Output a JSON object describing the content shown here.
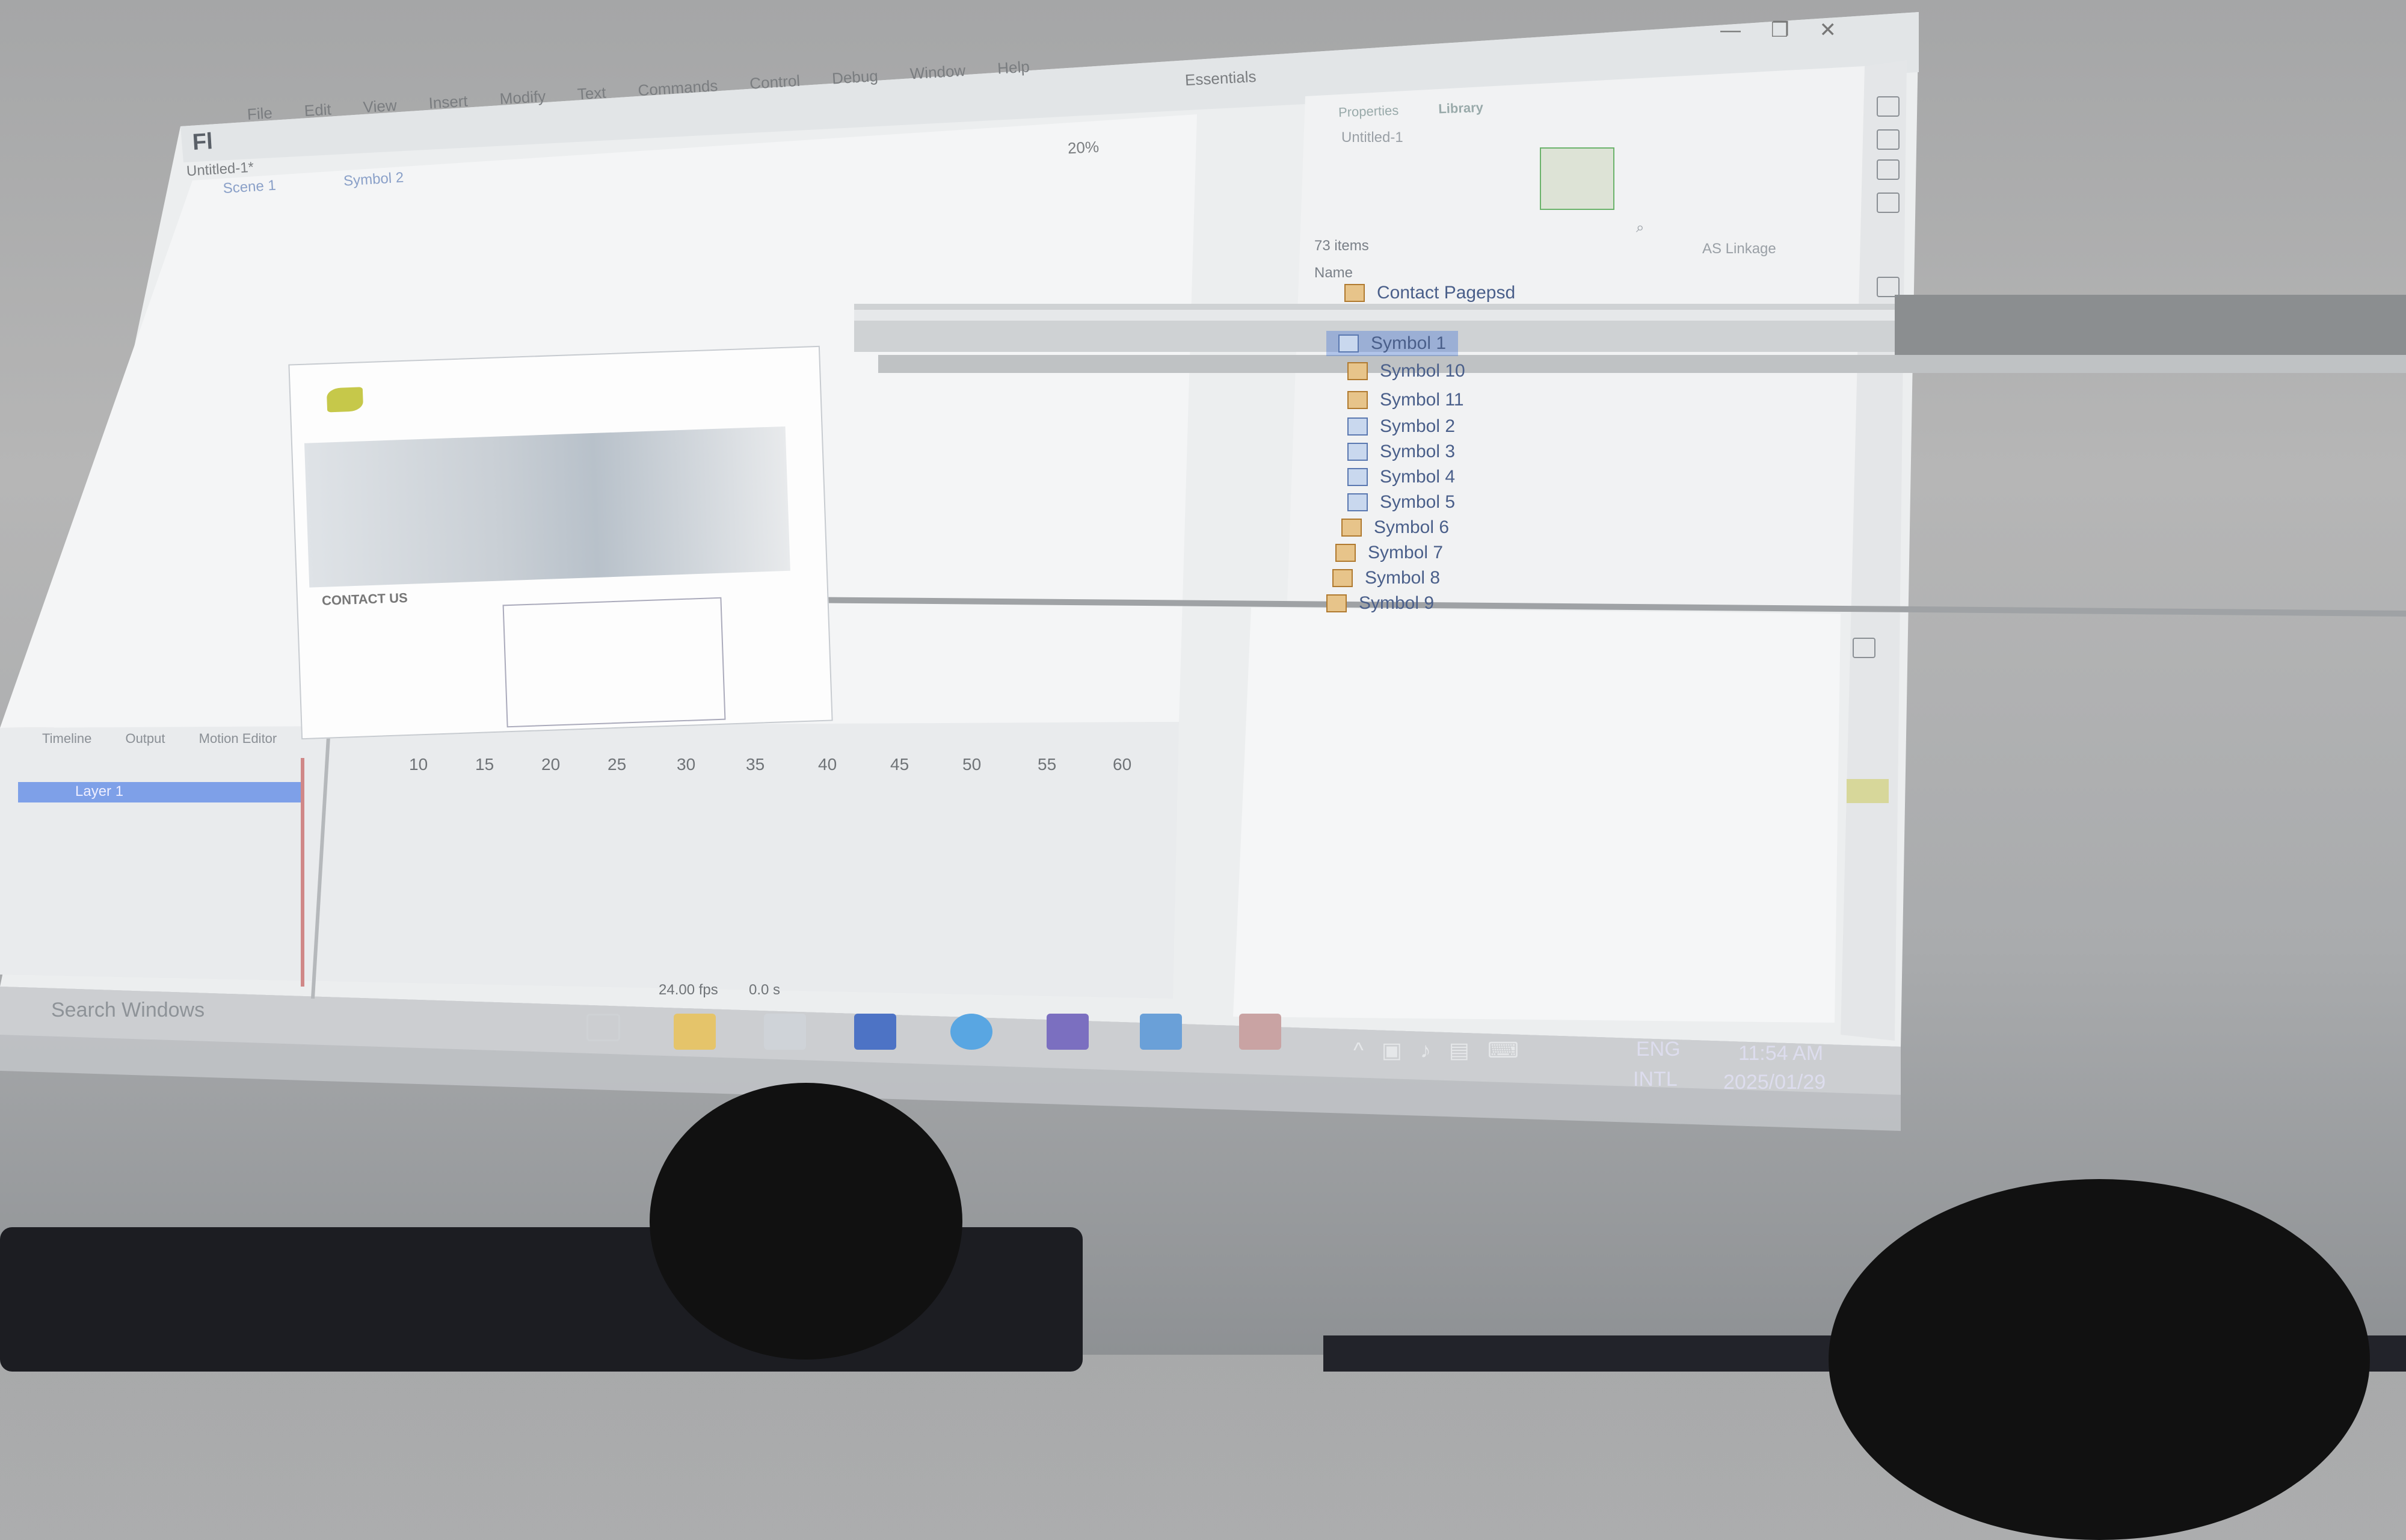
{
  "app": {
    "logo": "Fl",
    "menu": [
      "File",
      "Edit",
      "View",
      "Insert",
      "Modify",
      "Text",
      "Commands",
      "Control",
      "Debug",
      "Window",
      "Help"
    ],
    "workspace": "Essentials",
    "document_tab": "Untitled-1*",
    "breadcrumb": [
      "Scene 1",
      "Symbol 2"
    ],
    "zoom": "20%"
  },
  "panels": {
    "tabs": [
      "Properties",
      "Library"
    ],
    "library_doc": "Untitled-1",
    "items_count": "73 items",
    "column_name": "Name",
    "column_linkage": "AS Linkage",
    "items": [
      {
        "label": "Contact Pagepsd",
        "type": "folder"
      },
      {
        "label": "Symbol 1",
        "type": "symbol",
        "selected": true
      },
      {
        "label": "Symbol 10",
        "type": "folder"
      },
      {
        "label": "Symbol 11",
        "type": "folder"
      },
      {
        "label": "Symbol 2",
        "type": "symbol"
      },
      {
        "label": "Symbol 3",
        "type": "symbol"
      },
      {
        "label": "Symbol 4",
        "type": "symbol"
      },
      {
        "label": "Symbol 5",
        "type": "symbol"
      },
      {
        "label": "Symbol 6",
        "type": "folder"
      },
      {
        "label": "Symbol 7",
        "type": "folder"
      },
      {
        "label": "Symbol 8",
        "type": "folder"
      },
      {
        "label": "Symbol 9",
        "type": "folder"
      }
    ]
  },
  "timeline": {
    "tabs": [
      "Timeline",
      "Output",
      "Motion Editor"
    ],
    "layer": "Layer 1",
    "frame_numbers": [
      "10",
      "15",
      "20",
      "25",
      "30",
      "35",
      "40",
      "45",
      "50",
      "55",
      "60"
    ],
    "fps": "24.00 fps",
    "time": "0.0 s"
  },
  "stage_content": {
    "contact_heading": "CONTACT US"
  },
  "taskbar": {
    "search": "Search Windows",
    "lang_top": "ENG",
    "lang_bottom": "INTL",
    "time": "11:54 AM",
    "date": "2025/01/29"
  },
  "colors": {
    "accent_selection": "#3a6fd8",
    "taskbar": "#8f9396",
    "window_bg": "#eef0f1"
  }
}
